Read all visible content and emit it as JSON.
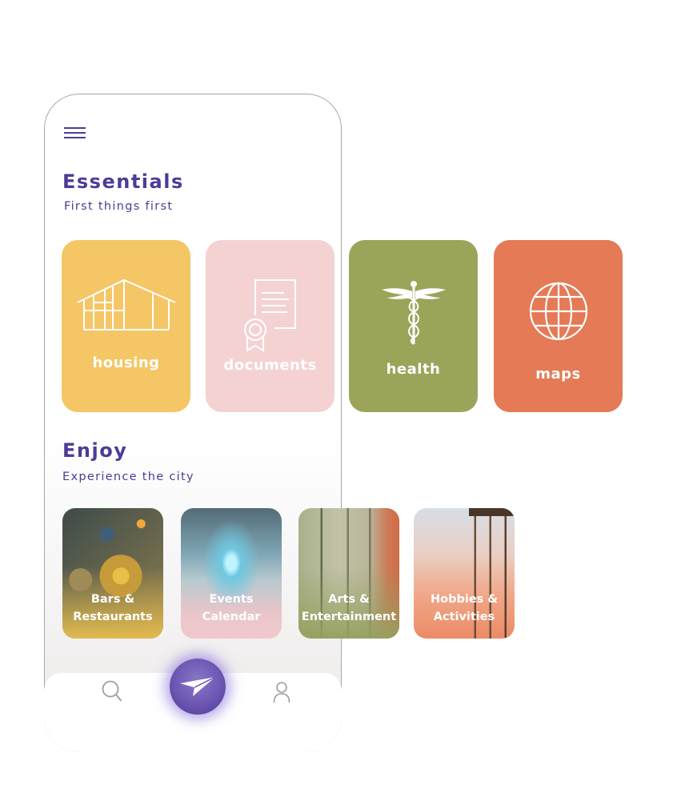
{
  "colors": {
    "accent": "#4e3b96",
    "housing": "#f5c666",
    "documents": "#f4d2d2",
    "health": "#9ca45a",
    "maps": "#e47a56",
    "fab": "#6b56b2"
  },
  "header": {
    "menu_icon": "hamburger-menu-icon"
  },
  "essentials": {
    "title": "Essentials",
    "subtitle": "First things first",
    "cards": [
      {
        "label": "housing",
        "icon": "house-frame-icon"
      },
      {
        "label": "documents",
        "icon": "certificate-document-icon"
      },
      {
        "label": "health",
        "icon": "caduceus-icon"
      },
      {
        "label": "maps",
        "icon": "globe-icon"
      }
    ]
  },
  "enjoy": {
    "title": "Enjoy",
    "subtitle": "Experience the city",
    "tiles": [
      {
        "line1": "Bars &",
        "line2": "Restaurants"
      },
      {
        "line1": "Events",
        "line2": "Calendar"
      },
      {
        "line1": "Arts &",
        "line2": "Entertainment"
      },
      {
        "line1": "Hobbies &",
        "line2": "Activities"
      }
    ]
  },
  "bottom_nav": {
    "search_icon": "search-icon",
    "fab_icon": "paper-plane-icon",
    "profile_icon": "user-profile-icon"
  }
}
